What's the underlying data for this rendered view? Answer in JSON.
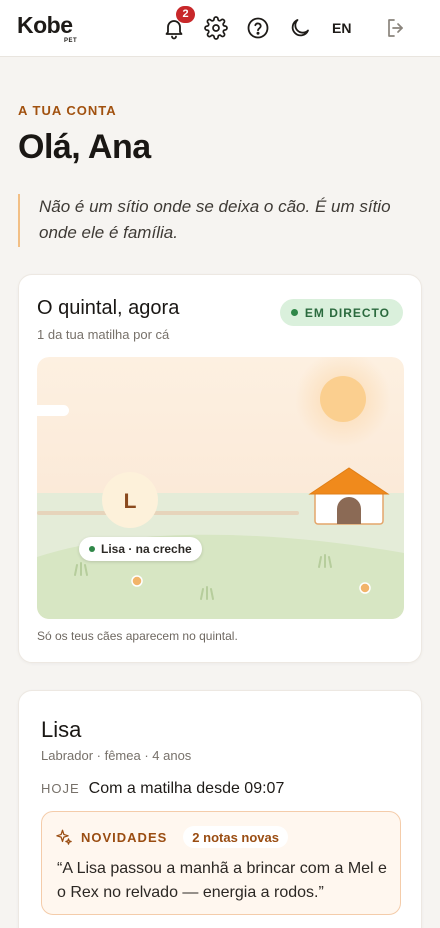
{
  "header": {
    "brand": "Kobe",
    "brand_sub": "PET",
    "notifications_count": "2",
    "language": "EN",
    "icons": [
      "bell-icon",
      "gear-icon",
      "help-icon",
      "moon-icon",
      "logout-icon"
    ]
  },
  "account": {
    "eyebrow": "A TUA CONTA",
    "greeting": "Olá, Ana",
    "quote": "Não é um sítio onde se deixa o cão. É um sítio onde ele é família."
  },
  "yard": {
    "title": "O quintal, agora",
    "subtitle": "1 da tua matilha por cá",
    "live_label": "EM DIRECTO",
    "dog_initial": "L",
    "dog_label": "Lisa · na creche",
    "note": "Só os teus cães aparecem no quintal."
  },
  "dog": {
    "name": "Lisa",
    "meta": "Labrador · fêmea · 4 anos",
    "today_label": "HOJE",
    "today_value": "Com a matilha desde 09:07",
    "news_title": "NOVIDADES",
    "news_count": "2 notas novas",
    "news_quote": "“A Lisa passou a manhã a brincar com a Mel e o Rex no relvado — energia a rodos.”"
  },
  "colors": {
    "accent": "#a1510f",
    "live_bg": "#daf0dc",
    "live_text": "#2b6a3e",
    "badge": "#c8282a",
    "house_roof": "#f08a1c"
  }
}
